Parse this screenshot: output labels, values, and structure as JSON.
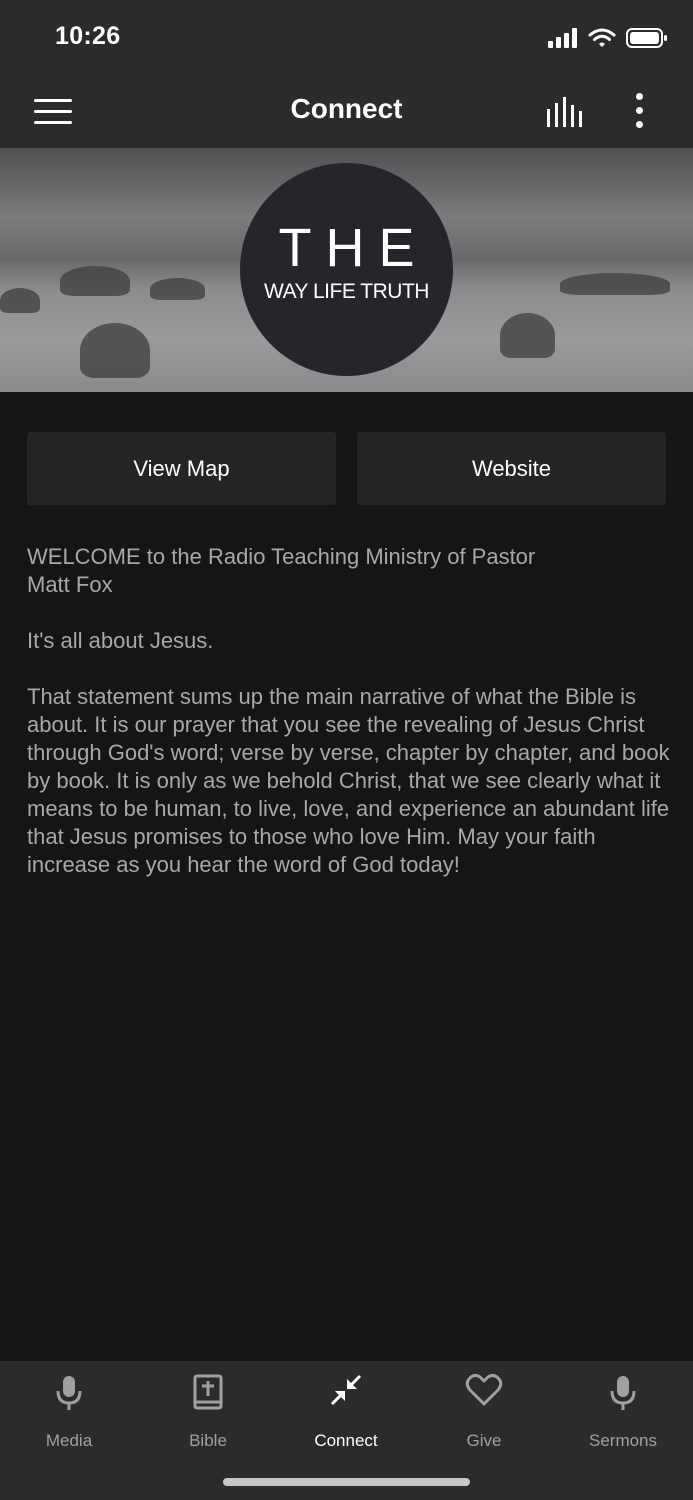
{
  "status_bar": {
    "time": "10:26"
  },
  "nav": {
    "title": "Connect"
  },
  "hero": {
    "logo_line1": "THE",
    "logo_line2": "WAY LIFE TRUTH"
  },
  "actions": {
    "map_label": "View Map",
    "website_label": "Website"
  },
  "content": {
    "paragraphs": [
      "WELCOME to the Radio Teaching Ministry of Pastor\nMatt Fox",
      "It's all about Jesus.",
      "That statement sums up the main narrative of what the Bible is about. It is our prayer that you see the revealing of Jesus Christ through God's word; verse by verse, chapter by chapter, and book by book. It is only as we behold Christ, that we see clearly what it means to be human, to live, love, and experience an abundant life that Jesus promises to those who love Him. May your faith increase as you hear the word of God today!"
    ]
  },
  "tabs": [
    {
      "label": "Media",
      "icon": "microphone-icon"
    },
    {
      "label": "Bible",
      "icon": "bible-icon"
    },
    {
      "label": "Connect",
      "icon": "connect-arrows-icon",
      "active": true
    },
    {
      "label": "Give",
      "icon": "heart-icon"
    },
    {
      "label": "Sermons",
      "icon": "microphone-icon"
    }
  ],
  "colors": {
    "background": "#151517",
    "bar": "#2b2b2d",
    "button": "#252527",
    "text_muted": "#a8a8aa",
    "active": "#ffffff"
  }
}
